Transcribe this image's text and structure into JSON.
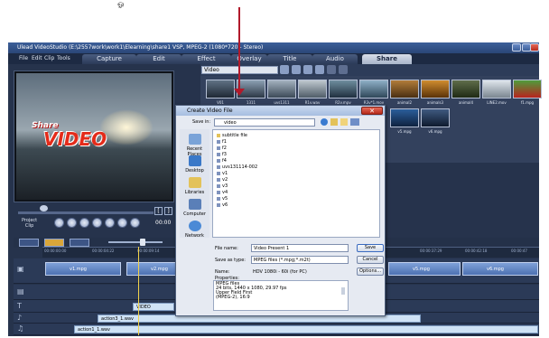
{
  "window": {
    "title": "Ulead VideoStudio (E:\\2557work\\work1\\Elearning\\share1 VSP, MPEG-2 (1080*720 - Stereo)"
  },
  "stray_glyph": "ஓ",
  "menu": {
    "file": "File",
    "edit": "Edit",
    "clip": "Clip",
    "tools": "Tools"
  },
  "steps": {
    "capture": "Capture",
    "edit": "Edit",
    "effect": "Effect",
    "overlay": "Overlay",
    "title": "Title",
    "audio": "Audio",
    "share": "Share"
  },
  "preview": {
    "overlay_share": "Share",
    "overlay_video": "VIDEO",
    "project_label": "Project",
    "clip_label": "Clip",
    "timecode": "00:00"
  },
  "library": {
    "category": "Video",
    "thumbs": [
      {
        "label": "V01"
      },
      {
        "label": "1311"
      },
      {
        "label": "uvs1311"
      },
      {
        "label": "R1v.wav"
      },
      {
        "label": "R2v.mpv"
      },
      {
        "label": "R3v*1.mov"
      },
      {
        "label": "animal2"
      },
      {
        "label": "animals3"
      },
      {
        "label": "animal4"
      },
      {
        "label": "LINE2.mov"
      },
      {
        "label": "f1.mpg"
      },
      {
        "label": "v5.mpg"
      },
      {
        "label": "v6.mpg"
      }
    ]
  },
  "timeline": {
    "ruler": [
      "00:00:00:00",
      "00:00:04:22",
      "00:00:09:14",
      "00:00:37:29",
      "00:00:42:18",
      "00:00:47"
    ],
    "video_clips": [
      {
        "label": "v1.mpg"
      },
      {
        "label": "v2.mpg"
      },
      {
        "label": "v5.mpg"
      },
      {
        "label": "v6.mpg"
      }
    ],
    "title_clip": "VIDEO",
    "audio_clips": [
      {
        "label": "action3_1.wav"
      },
      {
        "label": "action1_1.wav"
      }
    ]
  },
  "dialog": {
    "title": "Create Video File",
    "save_in_label": "Save in:",
    "save_in_value": "video",
    "places": [
      "Recent Places",
      "Desktop",
      "Libraries",
      "Computer",
      "Network"
    ],
    "files": [
      "subtitle file",
      "f1",
      "f2",
      "f3",
      "f4",
      "uvs131114-002",
      "v1",
      "v2",
      "v3",
      "v4",
      "v5",
      "v6"
    ],
    "file_name_label": "File name:",
    "file_name_value": "Video Present 1",
    "save_type_label": "Save as type:",
    "save_type_value": "MPEG files (*.mpg;*.m2t)",
    "name_label": "Name:",
    "name_value": "HDV 1080i - 60i (for PC)",
    "properties_label": "Properties:",
    "properties_text": "MPEG files\n24 bits, 1440 x 1080, 29.97 fps\nUpper Field First\n(MPEG-2), 16:9",
    "save_button": "Save",
    "cancel_button": "Cancel",
    "options_button": "Options..."
  }
}
